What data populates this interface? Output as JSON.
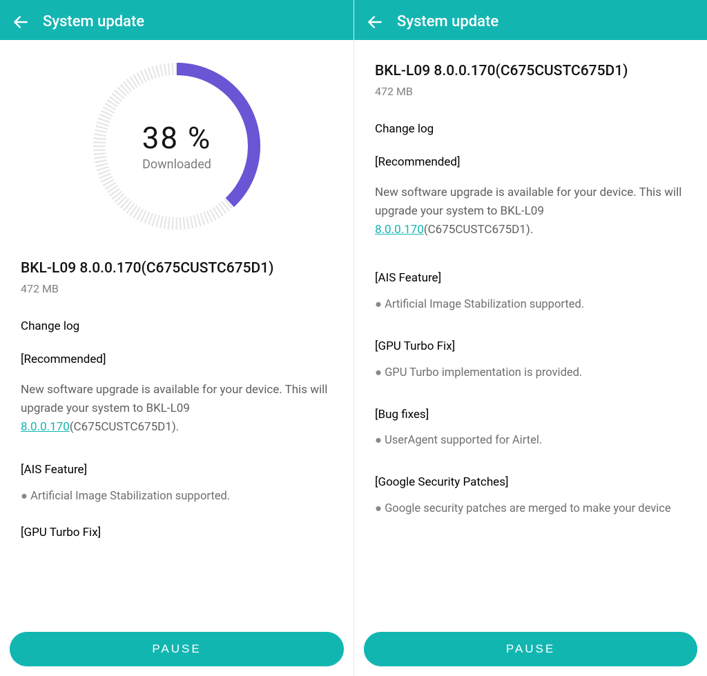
{
  "colors": {
    "accent": "#13b5b1",
    "progress_fill": "#6a55d4",
    "progress_track": "#e2e2e2"
  },
  "left": {
    "header": {
      "title": "System update"
    },
    "progress": {
      "percent": 38,
      "percent_text": "38 %",
      "status": "Downloaded"
    },
    "update": {
      "version": "BKL-L09 8.0.0.170(C675CUSTC675D1)",
      "size": "472 MB",
      "changelog_heading": "Change log",
      "recommended_heading": "[Recommended]",
      "paragraph_pre": "New software upgrade is available for your device. This will upgrade your system to BKL-L09 ",
      "version_link": "8.0.0.170",
      "paragraph_post": "(C675CUSTC675D1).",
      "ais_heading": "[AIS Feature]",
      "ais_bullet": "Artificial Image Stabilization supported.",
      "gpu_heading": "[GPU Turbo Fix]"
    },
    "button": {
      "label": "PAUSE"
    }
  },
  "right": {
    "header": {
      "title": "System update"
    },
    "update": {
      "version": "BKL-L09 8.0.0.170(C675CUSTC675D1)",
      "size": "472 MB",
      "changelog_heading": "Change log",
      "recommended_heading": "[Recommended]",
      "paragraph_pre": "New software upgrade is available for your device. This will upgrade your system to BKL-L09 ",
      "version_link": "8.0.0.170",
      "paragraph_post": "(C675CUSTC675D1).",
      "ais_heading": "[AIS Feature]",
      "ais_bullet": "Artificial Image Stabilization supported.",
      "gpu_heading": "[GPU Turbo Fix]",
      "gpu_bullet": "GPU Turbo implementation is provided.",
      "bug_heading": "[Bug fixes]",
      "bug_bullet": "UserAgent supported for Airtel.",
      "gsp_heading": "[Google Security Patches]",
      "gsp_bullet": "Google security patches are merged to make your device"
    },
    "button": {
      "label": "PAUSE"
    }
  }
}
